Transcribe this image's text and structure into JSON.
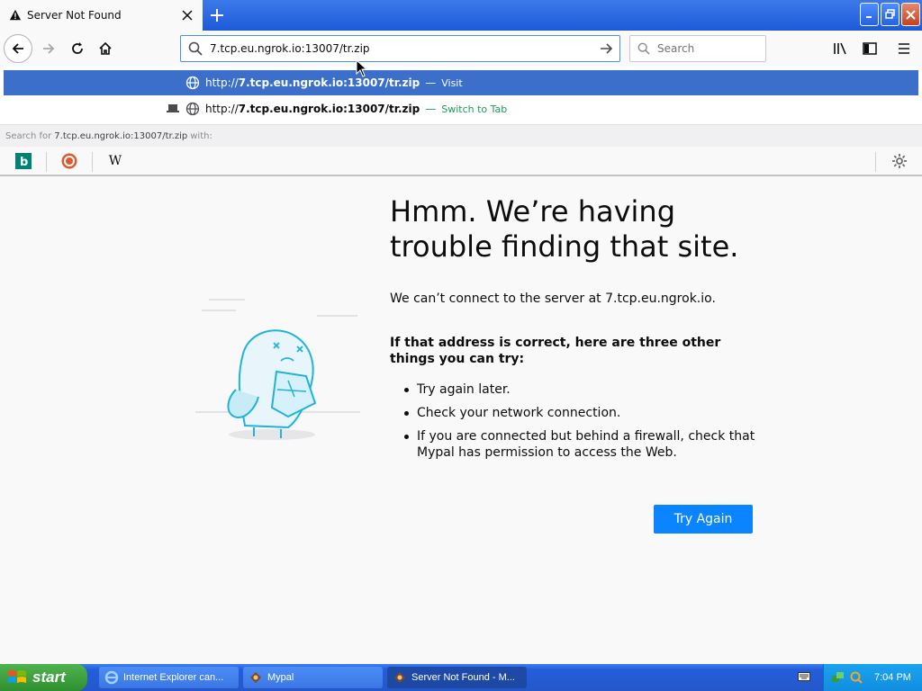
{
  "tab": {
    "title": "Server Not Found"
  },
  "nav": {
    "url": "7.tcp.eu.ngrok.io:13007/tr.zip",
    "search_placeholder": "Search"
  },
  "dropdown": {
    "row1": {
      "prefix": "http://",
      "url": "7.tcp.eu.ngrok.io:13007/tr.zip",
      "dash": "—",
      "action": "Visit"
    },
    "row2": {
      "prefix": "http://",
      "url": "7.tcp.eu.ngrok.io:13007/tr.zip",
      "dash": "—",
      "action": "Switch to Tab"
    },
    "search_for": {
      "label": "Search for",
      "query": "7.tcp.eu.ngrok.io:13007/tr.zip",
      "suffix": "with:"
    }
  },
  "engines": [
    {
      "name": "bing-engine",
      "glyph": "b"
    },
    {
      "name": "duckduckgo-engine",
      "glyph": ""
    },
    {
      "name": "wikipedia-engine",
      "glyph": "W"
    }
  ],
  "error": {
    "title": "Hmm. We’re having trouble finding that site.",
    "message": "We can’t connect to the server at 7.tcp.eu.ngrok.io.",
    "subtitle": "If that address is correct, here are three other things you can try:",
    "tips": [
      "Try again later.",
      "Check your network connection.",
      "If you are connected but behind a firewall, check that Mypal has permission to access the Web."
    ],
    "button": "Try Again"
  },
  "taskbar": {
    "start": "start",
    "tasks": [
      {
        "label": "Internet Explorer can...",
        "active": false
      },
      {
        "label": "Mypal",
        "active": false
      },
      {
        "label": "Server Not Found - M...",
        "active": true
      }
    ],
    "clock": "7:04 PM"
  },
  "colors": {
    "accent": "#0a84ff",
    "selected_row": "#3b6fc9",
    "switch_tab_green": "#1b9a5a"
  }
}
